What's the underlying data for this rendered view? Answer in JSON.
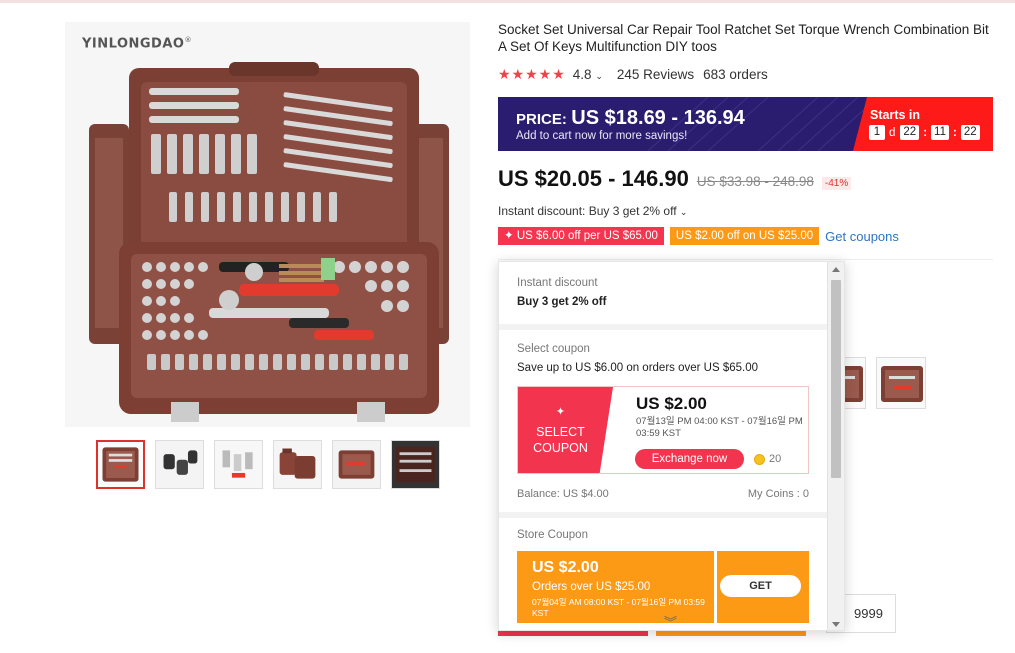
{
  "product": {
    "brand": "YINLONGDAO",
    "brand_mark": "®",
    "title": "Socket Set Universal Car Repair Tool Ratchet Set Torque Wrench Combination Bit A Set Of Keys Multifunction DIY toos",
    "rating_value": "4.8",
    "rating_stars": 4.8,
    "reviews": "245 Reviews",
    "orders": "683 orders",
    "thumbnail_count": 6
  },
  "promo": {
    "price_label": "PRICE:",
    "price_range": "US $18.69 - 136.94",
    "subtext": "Add to cart now for more savings!",
    "starts_in": "Starts in",
    "days": "1",
    "days_unit": "d",
    "hours": "22",
    "minutes": "11",
    "seconds": "22"
  },
  "pricing": {
    "price": "US $20.05 - 146.90",
    "original": "US $33.98 - 248.98",
    "discount": "-41%"
  },
  "instant_discount_text": "Instant discount: Buy 3 get 2% off",
  "coupons": {
    "tag1": "US $6.00 off per US $65.00",
    "tag2": "US $2.00 off on US $25.00",
    "get_coupons": "Get coupons"
  },
  "popup": {
    "instant_label": "Instant discount",
    "instant_value": "Buy 3 get 2% off",
    "select_label": "Select coupon",
    "select_desc": "Save up to US $6.00 on orders over US $65.00",
    "select_btn": "SELECT COUPON",
    "select_amount": "US $2.00",
    "select_date": "07월13일 PM 04:00 KST - 07월16일 PM 03:59 KST",
    "exchange": "Exchange now",
    "coin_cost": "20",
    "balance": "Balance: US $4.00",
    "my_coins": "My Coins : 0",
    "store_label": "Store Coupon",
    "store_amount": "US $2.00",
    "store_sub": "Orders over US $25.00",
    "store_date": "07월04일 AM 08:00 KST - 07월16일 PM 03:59 KST",
    "get": "GET"
  },
  "quantity_available": "9999",
  "colors": {
    "accent_red": "#f2344f",
    "orange": "#fd9a15",
    "promo_bg": "#2a1d6f",
    "link_blue": "#2f74c3"
  }
}
